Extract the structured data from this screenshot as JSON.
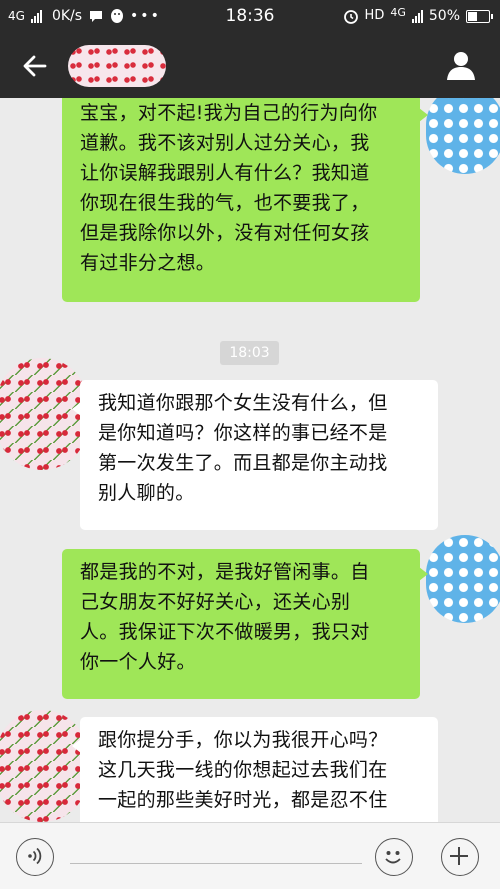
{
  "status_bar": {
    "network": "4G",
    "speed": "0K/s",
    "time": "18:36",
    "hd": "HD",
    "network_right": "4G",
    "battery": "50%"
  },
  "header": {
    "contact_name_redacted": true
  },
  "timestamp": "18:03",
  "messages": [
    {
      "direction": "out",
      "text": "宝宝，对不起!我为自己的行为向你\n道歉。我不该对别人过分关心，我\n让你误解我跟别人有什么？我知道\n你现在很生我的气，也不要我了，\n但是我除你以外，没有对任何女孩\n有过非分之想。"
    },
    {
      "direction": "in",
      "text": "我知道你跟那个女生没有什么，但\n是你知道吗？你这样的事已经不是\n第一次发生了。而且都是你主动找\n别人聊的。"
    },
    {
      "direction": "out",
      "text": "都是我的不对，是我好管闲事。自\n己女朋友不好好关心，还关心别\n人。我保证下次不做暖男，我只对\n你一个人好。"
    },
    {
      "direction": "in",
      "text": "跟你提分手，你以为我很开心吗？\n这几天我一线的你想起过去我们在\n一起的那些美好时光，都是忍不住"
    }
  ],
  "icons": {
    "back": "arrow-left-icon",
    "profile": "person-icon",
    "voice": "voice-icon",
    "emoji": "emoji-icon",
    "plus": "plus-icon"
  },
  "colors": {
    "header_bg": "#2b2b2b",
    "chat_bg": "#ebebeb",
    "outgoing_bubble": "#9fe658",
    "incoming_bubble": "#ffffff"
  }
}
